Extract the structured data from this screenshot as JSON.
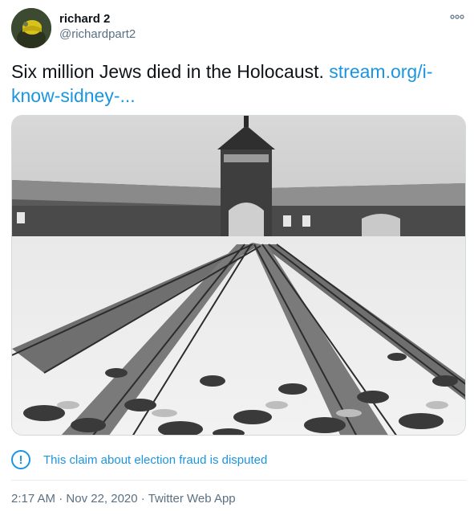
{
  "tweet": {
    "author": {
      "name": "richard 2",
      "handle": "@richardpart2"
    },
    "text": "Six million Jews died in the Holocaust. ",
    "link_text": "stream.org/i-know-sidney-...",
    "media": {
      "description_icon": "photo"
    },
    "notice": {
      "icon": "info-circle-icon",
      "icon_glyph": "!",
      "text": "This claim about election fraud is disputed"
    },
    "time": "2:17 AM",
    "separator": " · ",
    "date": "Nov 22, 2020",
    "source": "Twitter Web App"
  },
  "colors": {
    "accent": "#1b95e0",
    "secondary_text": "#5b7083",
    "primary_text": "#0f1419",
    "divider": "#e6ecf0"
  }
}
